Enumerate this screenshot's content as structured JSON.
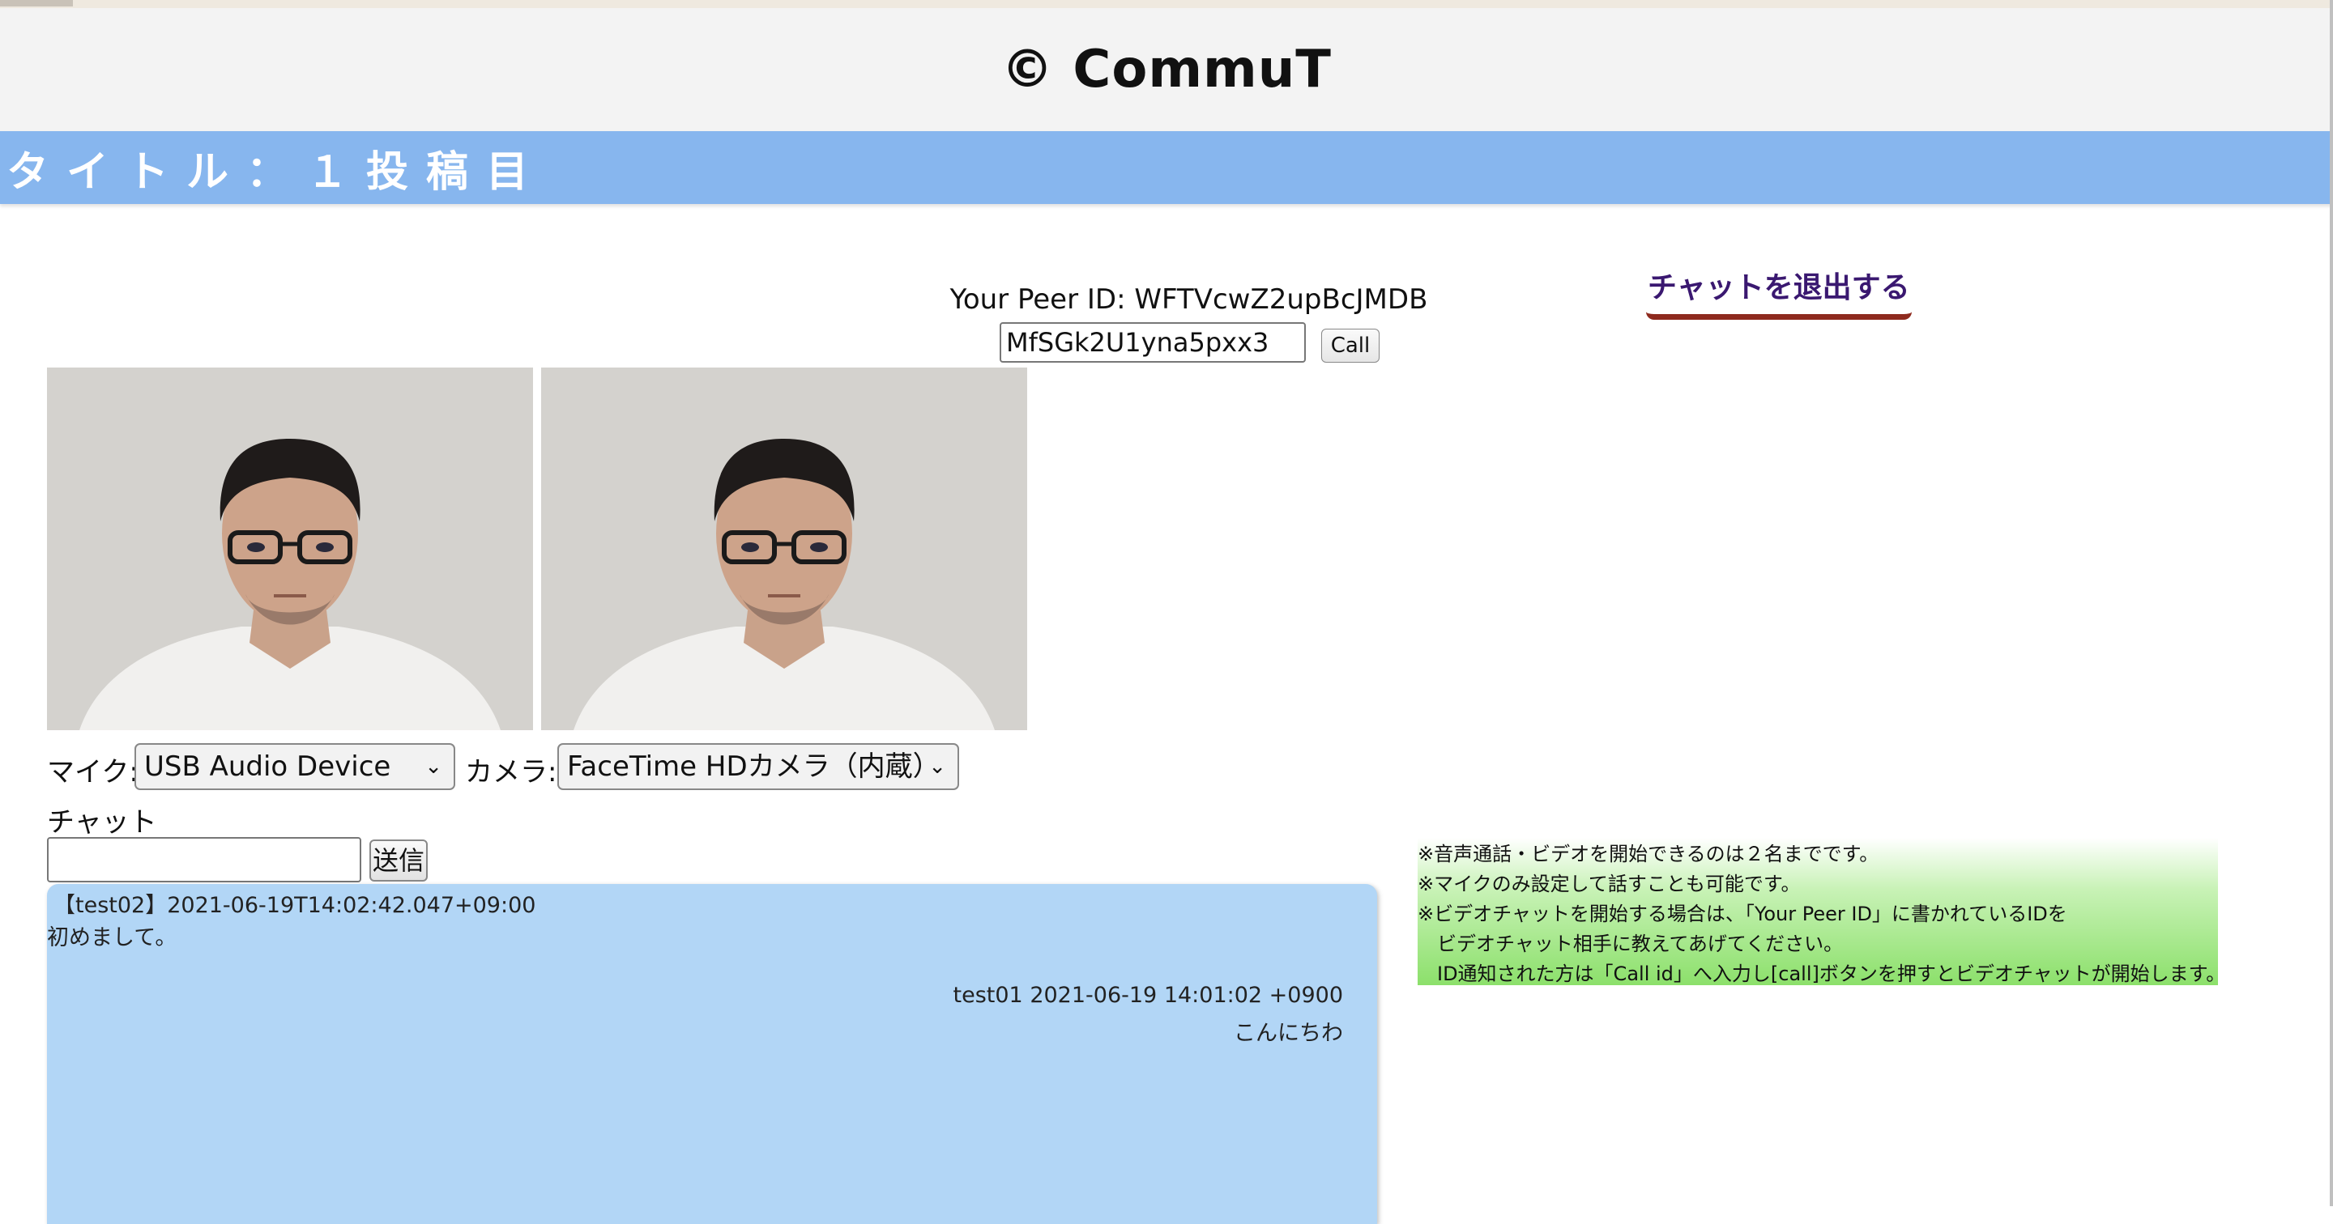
{
  "header": {
    "logo": "© CommuT"
  },
  "title_bar": {
    "text": "タイトル：１投稿目"
  },
  "peer": {
    "your_peer_id_text": "Your Peer ID: WFTVcwZ2upBcJMDB",
    "call_id_value": "MfSGk2U1yna5pxx3",
    "call_button": "Call"
  },
  "exit_link": "チャットを退出する",
  "devices": {
    "mic_label": "マイク:",
    "mic_selected": "USB Audio Device",
    "camera_label": "カメラ:",
    "camera_selected": "FaceTime HDカメラ（内蔵）"
  },
  "chat": {
    "heading": "チャット",
    "input_value": "",
    "send_button": "送信",
    "messages": [
      {
        "header": "【test02】2021-06-19T14:02:42.047+09:00",
        "body": "初めまして。",
        "align": "left"
      },
      {
        "header": "test01 2021-06-19 14:01:02 +0900",
        "body": "こんにちわ",
        "align": "right"
      }
    ]
  },
  "notice": {
    "lines": [
      "※音声通話・ビデオを開始できるのは２名までです。",
      "※マイクのみ設定して話すことも可能です。",
      "※ビデオチャットを開始する場合は、「Your Peer ID」に書かれているIDを",
      "ビデオチャット相手に教えてあげてください。",
      "ID通知された方は「Call id」へ入力し[call]ボタンを押すとビデオチャットが開始します。"
    ]
  },
  "colors": {
    "title_bar": "#87b6ee",
    "chat_bg": "#b2d6f6",
    "notice_green": "#8ce06b",
    "exit_link": "#3a1870",
    "exit_underline": "#8e2a1e"
  }
}
